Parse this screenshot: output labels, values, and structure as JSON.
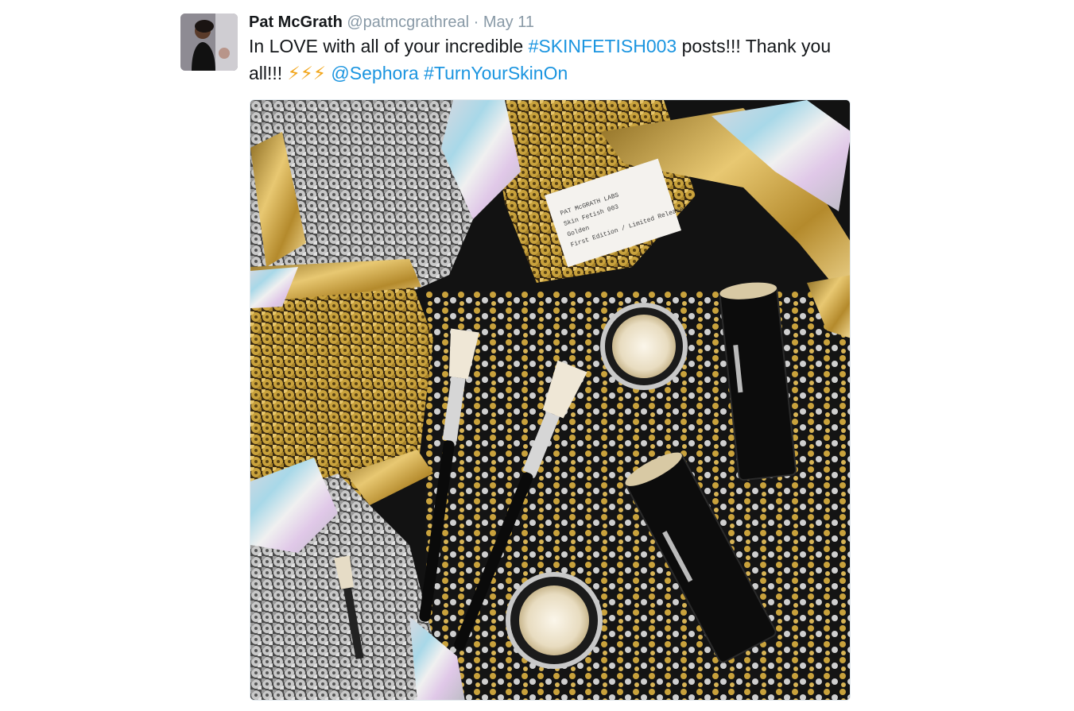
{
  "tweet": {
    "author_name": "Pat McGrath",
    "author_handle": "@patmcgrathreal",
    "separator": "·",
    "date": "May 11",
    "text_before_tag": "In LOVE with all of your incredible ",
    "hashtag_1": "#SKINFETISH003",
    "text_after_tag": " posts!!! Thank you all!!! ",
    "emoji": "⚡⚡⚡",
    "mention": "@Sephora",
    "hashtag_2": "#TurnYourSkinOn"
  },
  "media": {
    "label_card_lines": [
      "PAT McGRATH LABS",
      "Skin Fetish 003",
      "Golden",
      "First Edition / Limited Release"
    ]
  },
  "colors": {
    "link": "#1b95e0",
    "handle": "#8899a6",
    "text": "#14171a",
    "gold": "#c9a23c",
    "silver": "#b8b8b8"
  },
  "icons": {
    "avatar": "profile-photo",
    "emoji": "lightning-bolt"
  }
}
